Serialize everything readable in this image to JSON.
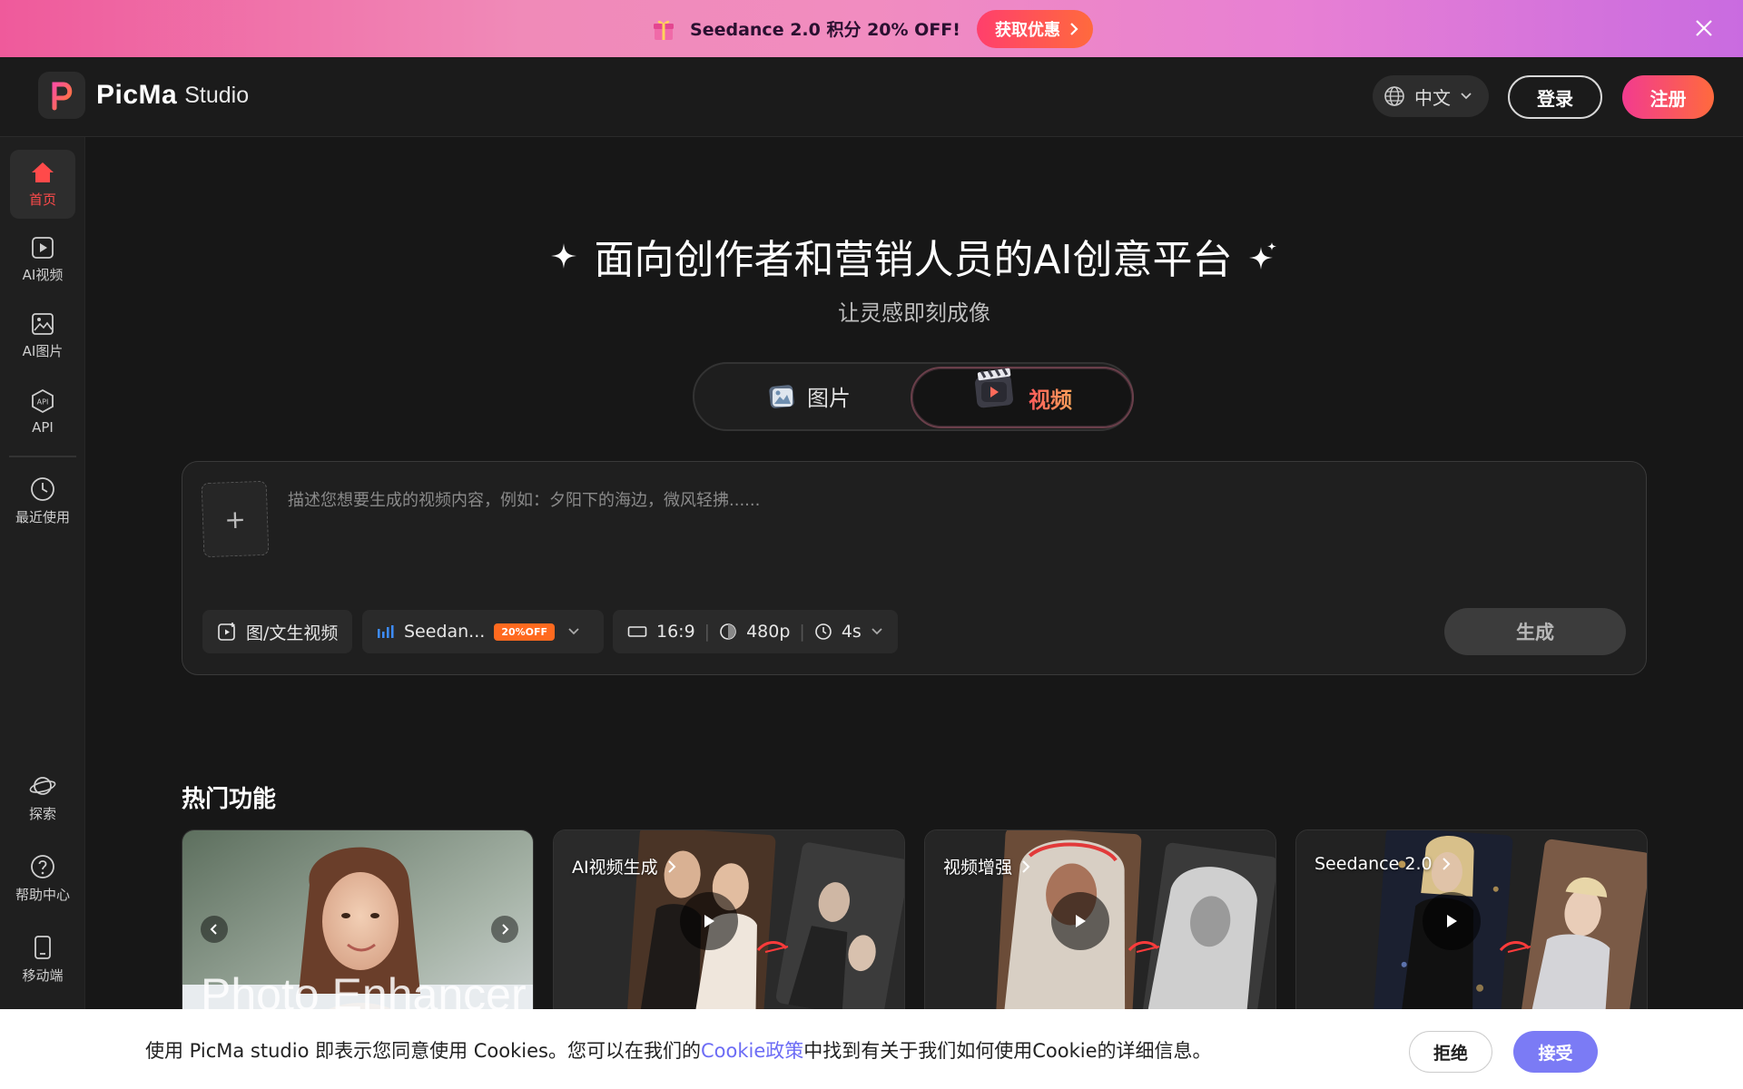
{
  "promo": {
    "text": "Seedance 2.0 积分 20% OFF!",
    "cta": "获取优惠",
    "icon": "gift-icon",
    "close_icon": "close-icon"
  },
  "header": {
    "brand": "PicMa",
    "brand_sub": "Studio",
    "language": "中文",
    "login": "登录",
    "signup": "注册"
  },
  "sidebar": {
    "items": [
      {
        "label": "首页",
        "icon": "home-icon",
        "active": true
      },
      {
        "label": "AI视频",
        "icon": "video-icon"
      },
      {
        "label": "AI图片",
        "icon": "image-icon"
      },
      {
        "label": "API",
        "icon": "api-icon"
      },
      {
        "label": "最近使用",
        "icon": "clock-icon"
      },
      {
        "label": "探索",
        "icon": "planet-icon"
      },
      {
        "label": "帮助中心",
        "icon": "help-icon"
      },
      {
        "label": "移动端",
        "icon": "mobile-icon"
      }
    ]
  },
  "hero": {
    "title": "面向创作者和营销人员的AI创意平台",
    "subtitle": "让灵感即刻成像"
  },
  "mode_toggle": {
    "image": "图片",
    "video": "视频",
    "selected": "视频"
  },
  "prompt": {
    "upload_symbol": "+",
    "placeholder": "描述您想要生成的视频内容，例如：夕阳下的海边，微风轻拂......",
    "mode_label": "图/文生视频",
    "model_label": "Seedan...",
    "model_badge": "20%OFF",
    "aspect": "16:9",
    "resolution": "480p",
    "duration": "4s",
    "generate": "生成"
  },
  "hot_features": {
    "title": "热门功能",
    "cards": [
      {
        "label": "",
        "overlay_text": "Photo Enhancer"
      },
      {
        "label": "AI视频生成"
      },
      {
        "label": "视频增强"
      },
      {
        "label": "Seedance 2.0"
      }
    ]
  },
  "cookie": {
    "text_before": "使用 PicMa studio 即表示您同意使用 Cookies。您可以在我们的",
    "link": "Cookie政策",
    "text_after": "中找到有关于我们如何使用Cookie的详细信息。",
    "reject": "拒绝",
    "accept": "接受"
  }
}
